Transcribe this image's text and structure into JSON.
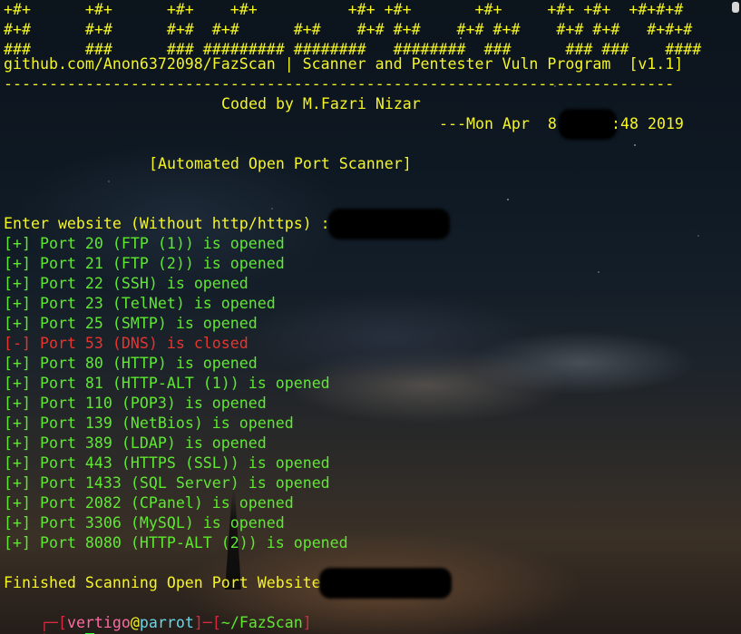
{
  "banner": [
    "+#+      +#+      +#+    +#+          +#+ +#+       +#+     +#+ +#+  +#+#+#",
    "#+#      #+#      #+#  #+#      #+#    #+# #+#    #+# #+#    #+# #+#   #+#+#",
    "###      ###      ### ######### ########   ########  ###      ### ###    ####"
  ],
  "github_line": "github.com/Anon6372098/FazScan | Scanner and Pentester Vuln Program  [v1.1]",
  "separator": "--------------------------------------------------------------------------",
  "coded_by": "Coded by M.Fazri Nizar",
  "date_prefix": "---Mon Apr  8",
  "date_suffix": ":48 2019",
  "mode_title": "[Automated Open Port Scanner]",
  "prompt_input": "Enter website (Without http/https) :",
  "ports": [
    {
      "mark": "[+]",
      "text": "Port 20 (FTP (1)) is opened",
      "status": "open"
    },
    {
      "mark": "[+]",
      "text": "Port 21 (FTP (2)) is opened",
      "status": "open"
    },
    {
      "mark": "[+]",
      "text": "Port 22 (SSH) is opened",
      "status": "open"
    },
    {
      "mark": "[+]",
      "text": "Port 23 (TelNet) is opened",
      "status": "open"
    },
    {
      "mark": "[+]",
      "text": "Port 25 (SMTP) is opened",
      "status": "open"
    },
    {
      "mark": "[-]",
      "text": "Port 53 (DNS) is closed",
      "status": "closed"
    },
    {
      "mark": "[+]",
      "text": "Port 80 (HTTP) is opened",
      "status": "open"
    },
    {
      "mark": "[+]",
      "text": "Port 81 (HTTP-ALT (1)) is opened",
      "status": "open"
    },
    {
      "mark": "[+]",
      "text": "Port 110 (POP3) is opened",
      "status": "open"
    },
    {
      "mark": "[+]",
      "text": "Port 139 (NetBios) is opened",
      "status": "open"
    },
    {
      "mark": "[+]",
      "text": "Port 389 (LDAP) is opened",
      "status": "open"
    },
    {
      "mark": "[+]",
      "text": "Port 443 (HTTPS (SSL)) is opened",
      "status": "open"
    },
    {
      "mark": "[+]",
      "text": "Port 1433 (SQL Server) is opened",
      "status": "open"
    },
    {
      "mark": "[+]",
      "text": "Port 2082 (CPanel) is opened",
      "status": "open"
    },
    {
      "mark": "[+]",
      "text": "Port 3306 (MySQL) is opened",
      "status": "open"
    },
    {
      "mark": "[+]",
      "text": "Port 8080 (HTTP-ALT (2)) is opened",
      "status": "open"
    }
  ],
  "finished": "Finished Scanning Open Port Website",
  "shell_prompt": {
    "corner_top": "┌─",
    "lbracket": "[",
    "user": "vertigo",
    "at": "@",
    "host": "parrot",
    "rbracket": "]",
    "dash": "─",
    "lpath": "[",
    "path": "~/FazScan",
    "rpath": "]",
    "corner_bottom": "└──╼",
    "symbol": "$"
  },
  "colors": {
    "banner": "#f5f523",
    "open": "#5ee830",
    "closed": "#e8342e",
    "prompt_bracket": "#d8283e",
    "user": "#ff6aa4",
    "host": "#67d6e8",
    "cursor": "#2cff2c"
  }
}
